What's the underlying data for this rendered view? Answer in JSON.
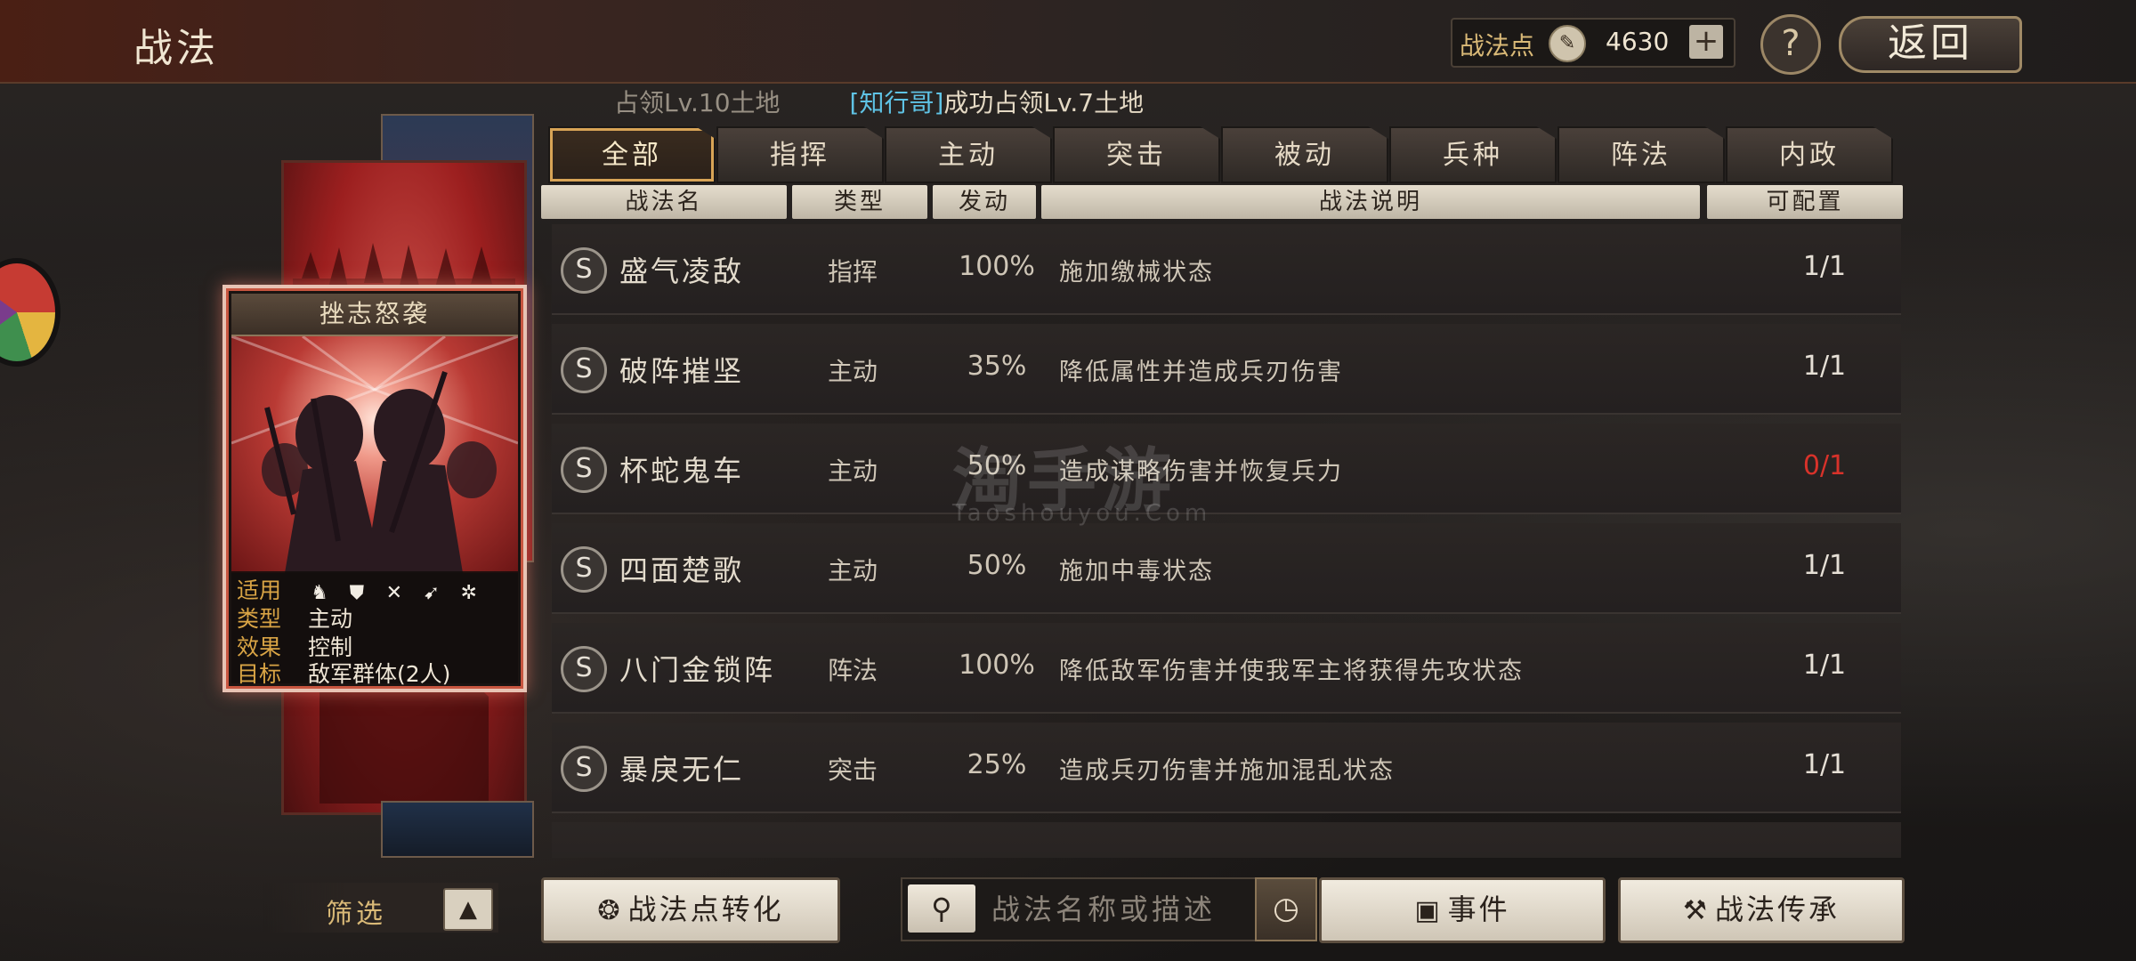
{
  "header": {
    "title": "战法",
    "points_label": "战法点",
    "points_value": "4630",
    "add_label": "+",
    "help_label": "?",
    "back_label": "返回"
  },
  "ticker": {
    "first": "占领Lv.10土地",
    "player": "[知行哥]",
    "second": "成功占领Lv.7土地"
  },
  "card": {
    "title": "挫志怒袭",
    "rows": [
      {
        "key": "适用",
        "value": ""
      },
      {
        "key": "类型",
        "value": "主动"
      },
      {
        "key": "效果",
        "value": "控制"
      },
      {
        "key": "目标",
        "value": "敌军群体(2人)"
      }
    ],
    "troop_icons": [
      "cavalry-icon",
      "shield-icon",
      "crossed-bow-icon",
      "spear-icon",
      "wheel-icon"
    ]
  },
  "tabs": [
    "全部",
    "指挥",
    "主动",
    "突击",
    "被动",
    "兵种",
    "阵法",
    "内政"
  ],
  "active_tab": "全部",
  "columns": {
    "name": "战法名",
    "type": "类型",
    "trigger": "发动",
    "description": "战法说明",
    "available": "可配置"
  },
  "skills": [
    {
      "grade": "S",
      "name": "盛气凌敌",
      "type": "指挥",
      "rate": "100%",
      "desc": "施加缴械状态",
      "avail": "1/1",
      "avail_color": "#e6e0d6"
    },
    {
      "grade": "S",
      "name": "破阵摧坚",
      "type": "主动",
      "rate": "35%",
      "desc": "降低属性并造成兵刃伤害",
      "avail": "1/1",
      "avail_color": "#e6e0d6"
    },
    {
      "grade": "S",
      "name": "杯蛇鬼车",
      "type": "主动",
      "rate": "50%",
      "desc": "造成谋略伤害并恢复兵力",
      "avail": "0/1",
      "avail_color": "#d8322a"
    },
    {
      "grade": "S",
      "name": "四面楚歌",
      "type": "主动",
      "rate": "50%",
      "desc": "施加中毒状态",
      "avail": "1/1",
      "avail_color": "#e6e0d6"
    },
    {
      "grade": "S",
      "name": "八门金锁阵",
      "type": "阵法",
      "rate": "100%",
      "desc": "降低敌军伤害并使我军主将获得先攻状态",
      "avail": "1/1",
      "avail_color": "#e6e0d6"
    },
    {
      "grade": "S",
      "name": "暴戾无仁",
      "type": "突击",
      "rate": "25%",
      "desc": "造成兵刃伤害并施加混乱状态",
      "avail": "1/1",
      "avail_color": "#e6e0d6"
    }
  ],
  "watermark": {
    "main": "淘手游",
    "sub": "Taoshouyou.Com"
  },
  "footer": {
    "filter_label": "筛选",
    "filter_toggle": "▲",
    "convert_label": "战法点转化",
    "search_placeholder": "战法名称或描述",
    "event_label": "事件",
    "inherit_label": "战法传承"
  }
}
